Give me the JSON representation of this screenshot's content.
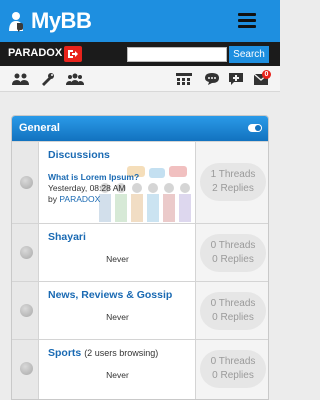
{
  "header": {
    "logo_text": "MyBB",
    "menu_icon": "hamburger-icon"
  },
  "userbar": {
    "username": "PARADOX",
    "logout_icon": "logout-icon",
    "search_placeholder": "",
    "search_button": "Search"
  },
  "toolbar": {
    "icons": [
      "members-icon",
      "tools-icon",
      "group-icon",
      "calendar-icon",
      "chat-icon",
      "new-message-icon",
      "messages-icon"
    ],
    "notification_count": "0"
  },
  "category": {
    "title": "General",
    "toggle_icon": "collapse-toggle-icon"
  },
  "forums": [
    {
      "name": "Discussions",
      "threads": "1 Threads",
      "replies": "2 Replies",
      "last_post": {
        "title": "What is Lorem Ipsum?",
        "date": "Yesterday, 08:28 AM",
        "by": "by",
        "author": "PARADOX"
      }
    },
    {
      "name": "Shayari",
      "last": "Never",
      "threads": "0 Threads",
      "replies": "0 Replies"
    },
    {
      "name": "News, Reviews & Gossip",
      "last": "Never",
      "threads": "0 Threads",
      "replies": "0 Replies"
    },
    {
      "name": "Sports",
      "browsing": "(2 users browsing)",
      "last": "Never",
      "threads": "0 Threads",
      "replies": "0 Replies"
    }
  ],
  "colors": {
    "accent": "#1e8fe0",
    "header_dark": "#1b1b1b",
    "link": "#1a6ab3",
    "danger": "#e8231c"
  }
}
